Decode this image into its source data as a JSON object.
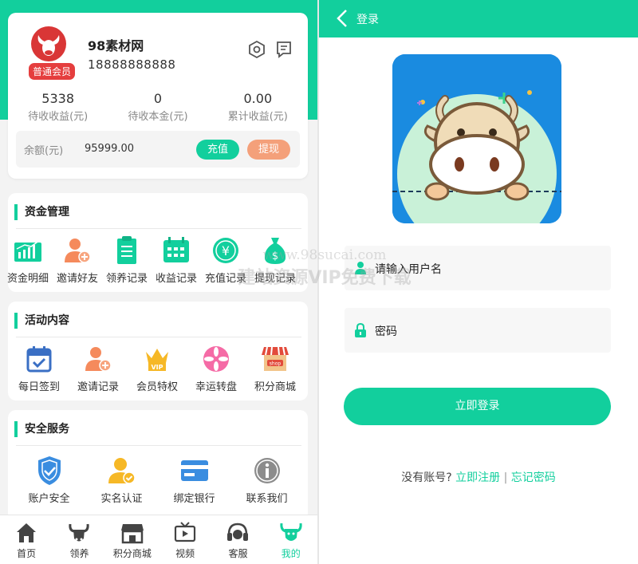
{
  "colors": {
    "primary": "#12cf9d",
    "recharge": "#12cf9d",
    "withdraw": "#f4a07a",
    "badge": "#e53e3e"
  },
  "profile": {
    "name": "98素材网",
    "phone": "18888888888",
    "level_badge": "普通会员"
  },
  "stats": [
    {
      "value": "5338",
      "label": "待收收益(元)"
    },
    {
      "value": "0",
      "label": "待收本金(元)"
    },
    {
      "value": "0.00",
      "label": "累计收益(元)"
    }
  ],
  "balance": {
    "label": "余额(元)",
    "value": "95999.00",
    "recharge": "充值",
    "withdraw": "提现"
  },
  "sections": {
    "funds": {
      "title": "资金管理",
      "items": [
        {
          "label": "资金明细",
          "icon": "chart-bar-icon"
        },
        {
          "label": "邀请好友",
          "icon": "invite-user-icon"
        },
        {
          "label": "领养记录",
          "icon": "list-doc-icon"
        },
        {
          "label": "收益记录",
          "icon": "calendar-icon"
        },
        {
          "label": "充值记录",
          "icon": "yen-coin-icon"
        },
        {
          "label": "提现记录",
          "icon": "money-bag-icon"
        }
      ]
    },
    "activity": {
      "title": "活动内容",
      "items": [
        {
          "label": "每日签到",
          "icon": "calendar-check-icon"
        },
        {
          "label": "邀请记录",
          "icon": "invite-user-icon"
        },
        {
          "label": "会员特权",
          "icon": "vip-crown-icon"
        },
        {
          "label": "幸运转盘",
          "icon": "lucky-wheel-icon"
        },
        {
          "label": "积分商城",
          "icon": "shop-icon"
        }
      ]
    },
    "security": {
      "title": "安全服务",
      "items": [
        {
          "label": "账户安全",
          "icon": "shield-check-icon"
        },
        {
          "label": "实名认证",
          "icon": "verified-user-icon"
        },
        {
          "label": "绑定银行",
          "icon": "bank-card-icon"
        },
        {
          "label": "联系我们",
          "icon": "info-icon"
        }
      ]
    }
  },
  "tabbar": [
    {
      "label": "首页",
      "icon": "home-icon"
    },
    {
      "label": "领养",
      "icon": "cow-icon"
    },
    {
      "label": "积分商城",
      "icon": "store-icon"
    },
    {
      "label": "视频",
      "icon": "video-icon"
    },
    {
      "label": "客服",
      "icon": "headset-icon"
    },
    {
      "label": "我的",
      "icon": "cow-head-icon",
      "active": true
    }
  ],
  "login": {
    "header_title": "登录",
    "username_placeholder": "请输入用户名",
    "password_placeholder": "密码",
    "submit": "立即登录",
    "no_account": "没有账号?",
    "register": "立即注册",
    "separator": "|",
    "forgot": "忘记密码"
  },
  "watermark": {
    "line1": "www.98sucai.com",
    "line2": "建站资源VIP免费下载"
  }
}
